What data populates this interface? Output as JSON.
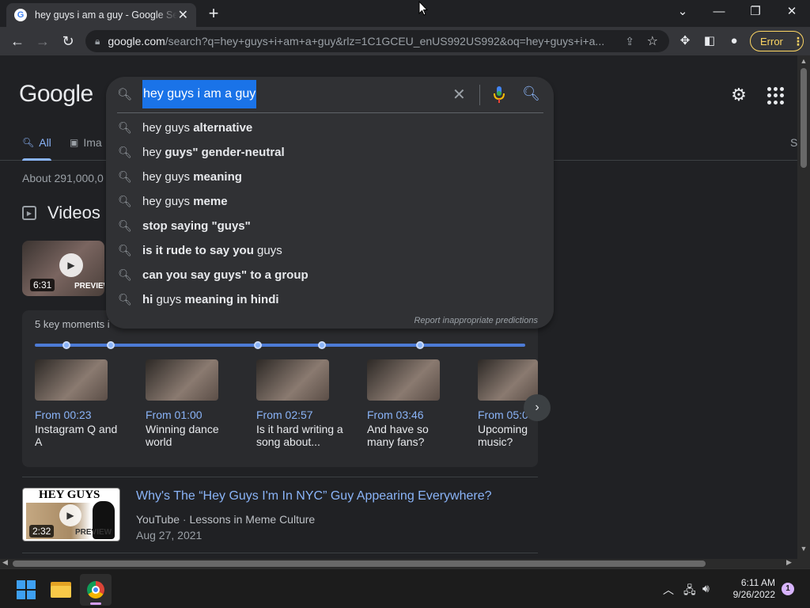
{
  "browser": {
    "tab_title": "hey guys i am a guy - Google Search",
    "tab_favicon": "G",
    "url_host": "google.com",
    "url_rest": "/search?q=hey+guys+i+am+a+guy&rlz=1C1GCEU_enUS992US992&oq=hey+guys+i+a...",
    "profile_button": "Error"
  },
  "search": {
    "logo": "Google",
    "query": "hey guys i am a guy",
    "suggestions": [
      {
        "plain": "hey guys ",
        "bold": "alternative",
        "tail": ""
      },
      {
        "plain": "hey ",
        "bold": "guys\" gender-neutral",
        "tail": ""
      },
      {
        "plain": "hey guys ",
        "bold": "meaning",
        "tail": ""
      },
      {
        "plain": "hey guys ",
        "bold": "meme",
        "tail": ""
      },
      {
        "plain": "",
        "bold": "stop saying \"guys\"",
        "tail": ""
      },
      {
        "plain": "",
        "bold": "is it rude to say you",
        "tail": " guys"
      },
      {
        "plain": "",
        "bold": "can you say guys\" to a group",
        "tail": ""
      },
      {
        "plain": "",
        "bold": "hi",
        "tail": " guys ",
        "bold2": "meaning in hindi"
      }
    ],
    "report": "Report inappropriate predictions"
  },
  "tabs": {
    "all": "All",
    "images": "Ima",
    "right_peek": "S"
  },
  "results_count": "About 291,000,0",
  "videos": {
    "heading": "Videos",
    "first": {
      "duration": "6:31",
      "preview": "PREVIEW"
    },
    "key_moments_label": "5 key moments i",
    "moments": [
      {
        "time": "From 00:23",
        "caption": "Instagram Q and A"
      },
      {
        "time": "From 01:00",
        "caption": "Winning dance world"
      },
      {
        "time": "From 02:57",
        "caption": "Is it hard writing a song about..."
      },
      {
        "time": "From 03:46",
        "caption": "And have so many fans?"
      },
      {
        "time": "From 05:0",
        "caption": "Upcoming music?"
      }
    ],
    "second": {
      "thumb_text": "HEY GUYS",
      "duration": "2:32",
      "preview": "PREVIEW",
      "title": "Why's The “Hey Guys I'm In NYC” Guy Appearing Everywhere?",
      "source": "YouTube",
      "channel": "Lessons in Meme Culture",
      "date": "Aug 27, 2021"
    }
  },
  "taskbar": {
    "time": "6:11 AM",
    "date": "9/26/2022",
    "notification_count": "1"
  },
  "colors": {
    "accent_link": "#8ab4f8",
    "selection": "#1a73e8",
    "error_badge": "#fdd663",
    "background": "#202124"
  },
  "icons": [
    "search-icon",
    "clear-icon",
    "mic-icon",
    "lens-icon",
    "gear-icon",
    "apps-icon",
    "back-icon",
    "forward-icon",
    "reload-icon",
    "lock-icon",
    "share-icon",
    "star-icon",
    "extensions-icon",
    "sidepanel-icon",
    "profile-icon",
    "windows-icon",
    "file-explorer-icon",
    "chrome-icon",
    "wifi-icon",
    "volume-icon",
    "chevron-up-icon"
  ]
}
